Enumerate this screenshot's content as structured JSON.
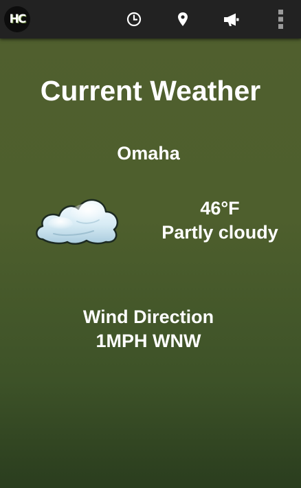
{
  "action_bar": {
    "logo_text": "HC",
    "icons": [
      "clock-icon",
      "location-pin-icon",
      "megaphone-icon",
      "overflow-menu-icon"
    ]
  },
  "main": {
    "title": "Current Weather",
    "city": "Omaha",
    "condition_icon": "partly-cloudy-icon",
    "temperature": "46°F",
    "condition": "Partly cloudy",
    "wind_label": "Wind Direction",
    "wind_value": "1MPH WNW"
  },
  "colors": {
    "action_bar": "#222222",
    "background_top": "#505f2e",
    "background_bottom": "#2a3d1e",
    "text": "#ffffff"
  }
}
